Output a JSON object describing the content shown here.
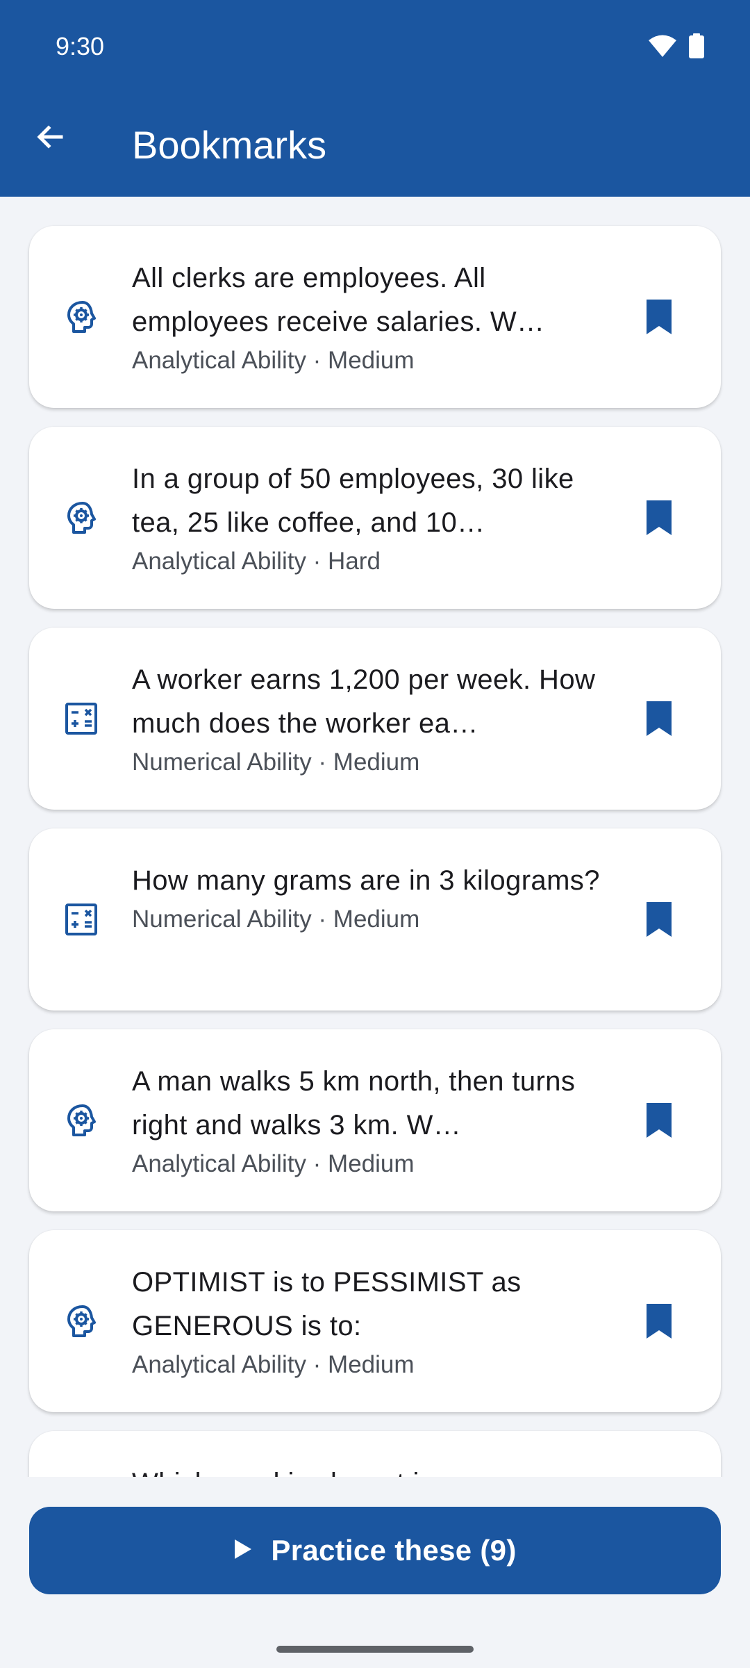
{
  "status_bar": {
    "time": "9:30",
    "icons": [
      "wifi-icon",
      "battery-icon"
    ]
  },
  "toolbar": {
    "back_icon": "arrow-left-icon",
    "title": "Bookmarks"
  },
  "colors": {
    "primary": "#1b56a0",
    "background": "#f2f4f8",
    "card": "#ffffff"
  },
  "bookmarks": [
    {
      "icon": "brain-gear-icon",
      "title": "All clerks are employees. All employees receive salaries. W…",
      "meta": "Analytical Ability · Medium"
    },
    {
      "icon": "brain-gear-icon",
      "title": "In a group of 50 employees, 30 like tea, 25 like coffee, and 10…",
      "meta": "Analytical Ability · Hard"
    },
    {
      "icon": "calculator-icon",
      "title": "A worker earns 1,200 per week. How much does the worker ea…",
      "meta": "Numerical Ability · Medium"
    },
    {
      "icon": "calculator-icon",
      "title": "How many grams are in 3 kilograms?",
      "meta": "Numerical Ability · Medium"
    },
    {
      "icon": "brain-gear-icon",
      "title": "A man walks 5 km north, then turns right and walks 3 km. W…",
      "meta": "Analytical Ability · Medium"
    },
    {
      "icon": "brain-gear-icon",
      "title": "OPTIMIST is to PESSIMIST as GENEROUS is to:",
      "meta": "Analytical Ability · Medium"
    },
    {
      "icon": "brain-gear-icon",
      "title": "Which word is closest in",
      "meta": ""
    }
  ],
  "practice_button": {
    "icon": "play-icon",
    "label": "Practice these (9)"
  }
}
